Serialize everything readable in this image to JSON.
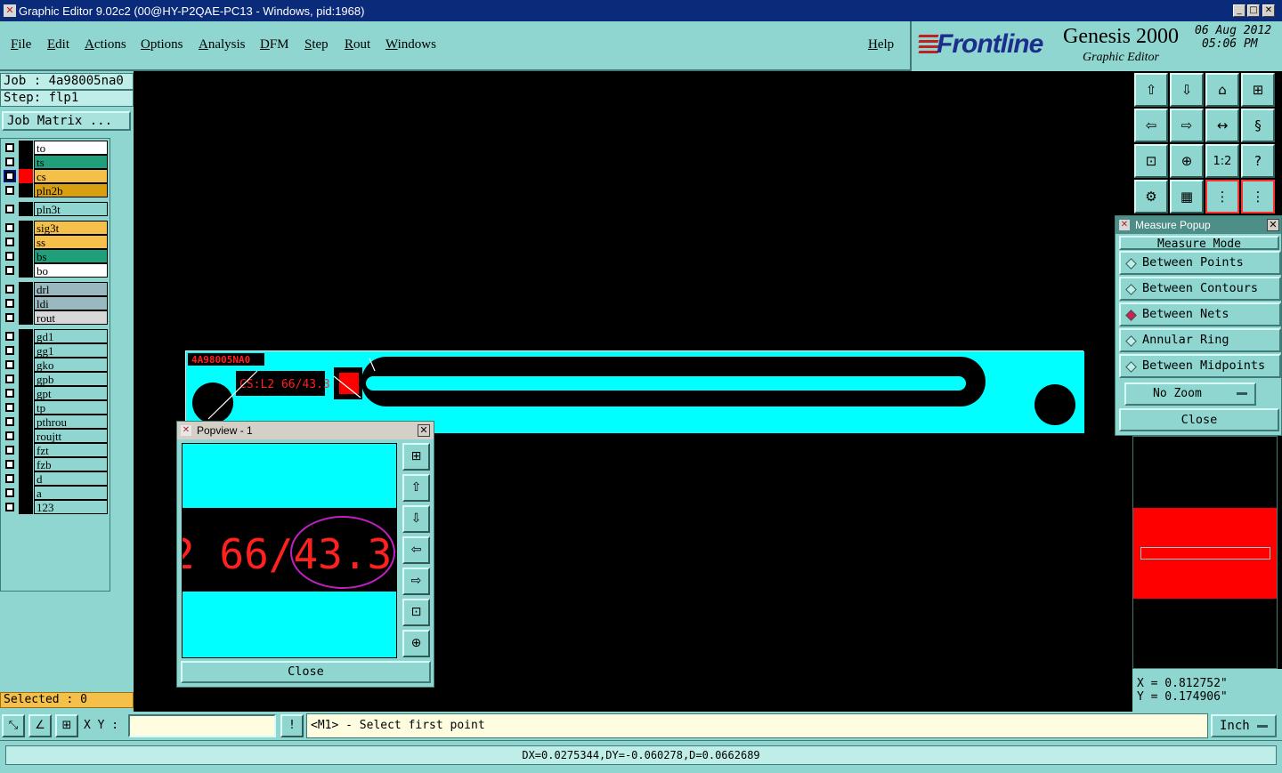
{
  "window": {
    "title": "Graphic Editor 9.02c2 (00@HY-P2QAE-PC13 - Windows, pid:1968)"
  },
  "menu": [
    "File",
    "Edit",
    "Actions",
    "Options",
    "Analysis",
    "DFM",
    "Step",
    "Rout",
    "Windows"
  ],
  "help": "Help",
  "brand": {
    "logo": "Frontline",
    "product": "Genesis 2000",
    "subtitle": "Graphic Editor",
    "date": "06 Aug 2012",
    "time": "05:06 PM"
  },
  "job": "Job : 4a98005na0",
  "step": "Step: flp1",
  "job_matrix": "Job Matrix ...",
  "layers": [
    {
      "name": "to",
      "color": "#ffffff"
    },
    {
      "name": "ts",
      "color": "#1fa07a"
    },
    {
      "name": "cs",
      "color": "#f5c04a"
    },
    {
      "name": "pln2b",
      "color": "#d8a010"
    },
    {
      "name": "pln3t",
      "color": "#8fd6d0"
    },
    {
      "name": "sig3t",
      "color": "#f5c04a"
    },
    {
      "name": "ss",
      "color": "#f5c04a"
    },
    {
      "name": "bs",
      "color": "#1fa07a"
    },
    {
      "name": "bo",
      "color": "#ffffff"
    },
    {
      "name": "drl",
      "color": "#9ab8c0"
    },
    {
      "name": "ldi",
      "color": "#9ab8c0"
    },
    {
      "name": "rout",
      "color": "#d8d8d8"
    },
    {
      "name": "gd1",
      "color": "#8fd6d0"
    },
    {
      "name": "gg1",
      "color": "#8fd6d0"
    },
    {
      "name": "gko",
      "color": "#8fd6d0"
    },
    {
      "name": "gpb",
      "color": "#8fd6d0"
    },
    {
      "name": "gpt",
      "color": "#8fd6d0"
    },
    {
      "name": "tp",
      "color": "#8fd6d0"
    },
    {
      "name": "pthrou",
      "color": "#8fd6d0"
    },
    {
      "name": "roujtt",
      "color": "#8fd6d0"
    },
    {
      "name": "fzt",
      "color": "#8fd6d0"
    },
    {
      "name": "fzb",
      "color": "#8fd6d0"
    },
    {
      "name": "d",
      "color": "#8fd6d0"
    },
    {
      "name": "a",
      "color": "#8fd6d0"
    },
    {
      "name": "123",
      "color": "#8fd6d0"
    }
  ],
  "selected": "Selected : 0",
  "measure": {
    "title": "Measure Popup",
    "mode_label": "Measure Mode",
    "options": [
      "Between Points",
      "Between Contours",
      "Between Nets",
      "Annular Ring",
      "Between Midpoints"
    ],
    "active": "Between Nets",
    "zoom": "No Zoom",
    "close": "Close"
  },
  "popview": {
    "title": "Popview - 1",
    "text": "2 66/43.3",
    "close": "Close"
  },
  "pcb": {
    "label1": "4A98005NA0",
    "label2": "CS:L2 66/43.3"
  },
  "coords": {
    "x": "X = 0.812752\"",
    "y": "Y = 0.174906\""
  },
  "cmd": {
    "xy_label": "X Y :",
    "xy_value": "",
    "prompt": "<M1> - Select first point",
    "unit": "Inch"
  },
  "status": "DX=0.0275344,DY=-0.060278,D=0.0662689",
  "colors": {
    "panel": "#8fd6d0",
    "copper": "#00ffff",
    "highlight": "#ff0000",
    "title": "#0a2a7a"
  }
}
